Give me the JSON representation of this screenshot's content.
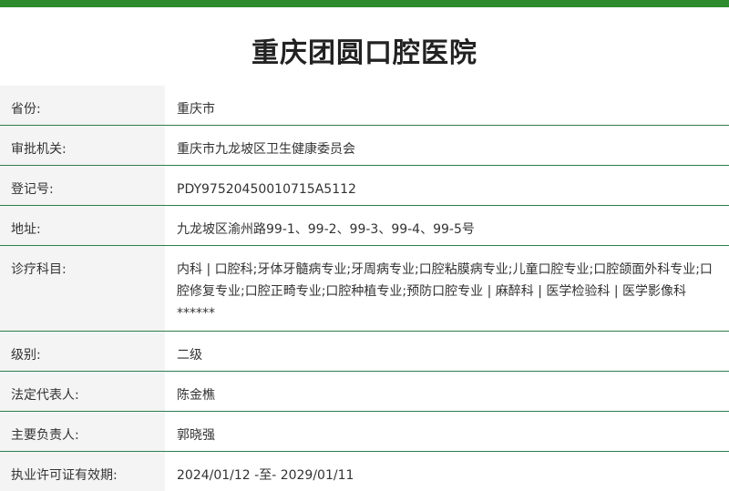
{
  "accent_color": "#2e8b2e",
  "divider_color": "#2e7d4f",
  "title": "重庆团圆口腔医院",
  "rows": [
    {
      "key": "省份:",
      "value": "重庆市"
    },
    {
      "key": "审批机关:",
      "value": "重庆市九龙坡区卫生健康委员会"
    },
    {
      "key": "登记号:",
      "value": "PDY97520450010715A5112"
    },
    {
      "key": "地址:",
      "value": "九龙坡区渝州路99-1、99-2、99-3、99-4、99-5号"
    },
    {
      "key": "诊疗科目:",
      "value": "内科 | 口腔科;牙体牙髓病专业;牙周病专业;口腔粘膜病专业;儿童口腔专业;口腔颌面外科专业;口腔修复专业;口腔正畸专业;口腔种植专业;预防口腔专业 | 麻醉科 | 医学检验科 | 医学影像科******"
    },
    {
      "key": "级别:",
      "value": "二级"
    },
    {
      "key": "法定代表人:",
      "value": "陈金樵"
    },
    {
      "key": "主要负责人:",
      "value": "郭晓强"
    },
    {
      "key": "执业许可证有效期:",
      "value": "2024/01/12 -至- 2029/01/11"
    }
  ]
}
